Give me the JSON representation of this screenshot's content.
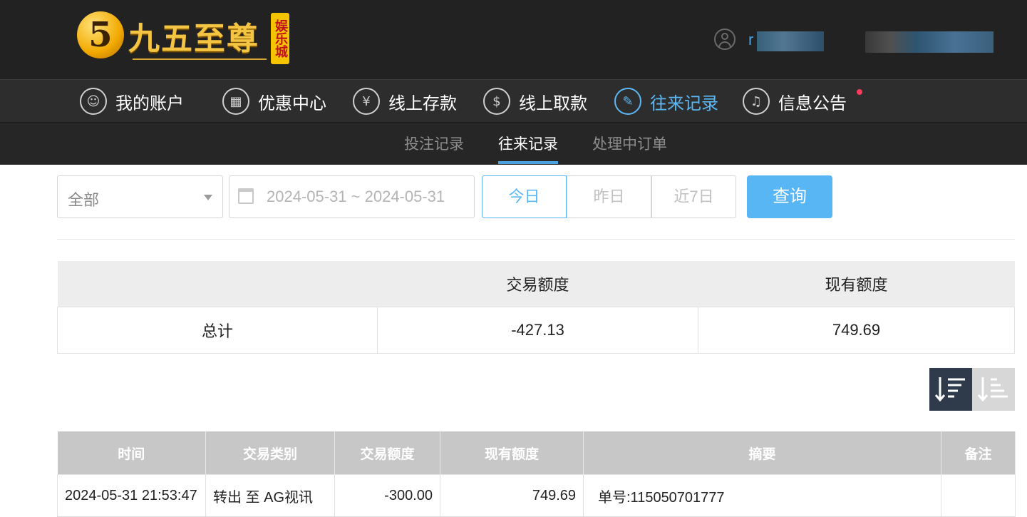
{
  "logo": {
    "mark": "5",
    "text": "九五至尊",
    "badge": "娱乐城"
  },
  "user": {
    "name": "r"
  },
  "nav": [
    {
      "label": "我的账户",
      "icon": "account-icon"
    },
    {
      "label": "优惠中心",
      "icon": "gift-icon"
    },
    {
      "label": "线上存款",
      "icon": "deposit-icon"
    },
    {
      "label": "线上取款",
      "icon": "withdraw-icon"
    },
    {
      "label": "往来记录",
      "icon": "records-icon",
      "active": true
    },
    {
      "label": "信息公告",
      "icon": "bell-icon"
    }
  ],
  "subnav": {
    "bets": "投注记录",
    "transactions": "往来记录",
    "pending": "处理中订单"
  },
  "filters": {
    "type_value": "全部",
    "date_range": "2024-05-31 ~ 2024-05-31",
    "today": "今日",
    "yesterday": "昨日",
    "last7": "近7日",
    "query": "查询"
  },
  "summary": {
    "headers": [
      "",
      "交易额度",
      "现有额度"
    ],
    "row": {
      "label": "总计",
      "amount": "-427.13",
      "balance": "749.69"
    }
  },
  "records": {
    "headers": [
      "时间",
      "交易类别",
      "交易额度",
      "现有额度",
      "摘要",
      "备注"
    ],
    "rows": [
      {
        "time": "2024-05-31 21:53:47",
        "type": "转出 至 AG视讯",
        "amount": "-300.00",
        "balance": "749.69",
        "summary": "单号:115050701777",
        "note": ""
      }
    ]
  },
  "colors": {
    "accent": "#5bb8f5",
    "header_bg": "#222222"
  }
}
